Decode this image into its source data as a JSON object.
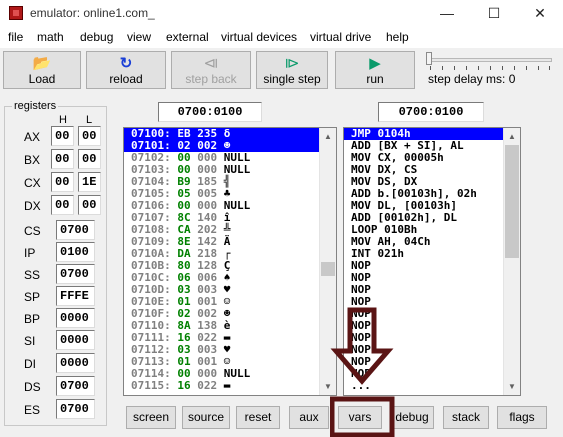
{
  "window": {
    "title": "emulator: online1.com_",
    "minimize": "—",
    "maximize": "☐",
    "close": "✕"
  },
  "menu": [
    "file",
    "math",
    "debug",
    "view",
    "external",
    "virtual devices",
    "virtual drive",
    "help"
  ],
  "toolbar": {
    "load": {
      "label": "Load",
      "icon": "📂"
    },
    "reload": {
      "label": "reload",
      "icon": "↻"
    },
    "step_back": {
      "label": "step back",
      "icon": "⧏",
      "disabled": true
    },
    "single_step": {
      "label": "single step",
      "icon": "⧐"
    },
    "run": {
      "label": "run",
      "icon": "▶"
    },
    "step_delay_label": "step delay ms: 0",
    "step_delay_ms": 0
  },
  "registers": {
    "caption": "registers",
    "h_header": "H",
    "l_header": "L",
    "general": [
      {
        "name": "AX",
        "h": "00",
        "l": "00"
      },
      {
        "name": "BX",
        "h": "00",
        "l": "00"
      },
      {
        "name": "CX",
        "h": "00",
        "l": "1E"
      },
      {
        "name": "DX",
        "h": "00",
        "l": "00"
      }
    ],
    "segment": [
      {
        "name": "CS",
        "value": "0700"
      },
      {
        "name": "IP",
        "value": "0100"
      },
      {
        "name": "SS",
        "value": "0700"
      },
      {
        "name": "SP",
        "value": "FFFE"
      },
      {
        "name": "BP",
        "value": "0000"
      },
      {
        "name": "SI",
        "value": "0000"
      },
      {
        "name": "DI",
        "value": "0000"
      },
      {
        "name": "DS",
        "value": "0700"
      },
      {
        "name": "ES",
        "value": "0700"
      }
    ]
  },
  "memory": {
    "address": "0700:0100",
    "rows": [
      {
        "addr": "07100:",
        "hex": "EB",
        "dec": "235",
        "ch": "δ",
        "selected": true
      },
      {
        "addr": "07101:",
        "hex": "02",
        "dec": "002",
        "ch": "☻",
        "selected": true
      },
      {
        "addr": "07102:",
        "hex": "00",
        "dec": "000",
        "ch": "NULL"
      },
      {
        "addr": "07103:",
        "hex": "00",
        "dec": "000",
        "ch": "NULL"
      },
      {
        "addr": "07104:",
        "hex": "B9",
        "dec": "185",
        "ch": "╣"
      },
      {
        "addr": "07105:",
        "hex": "05",
        "dec": "005",
        "ch": "♣"
      },
      {
        "addr": "07106:",
        "hex": "00",
        "dec": "000",
        "ch": "NULL"
      },
      {
        "addr": "07107:",
        "hex": "8C",
        "dec": "140",
        "ch": "î"
      },
      {
        "addr": "07108:",
        "hex": "CA",
        "dec": "202",
        "ch": "╩"
      },
      {
        "addr": "07109:",
        "hex": "8E",
        "dec": "142",
        "ch": "Ä"
      },
      {
        "addr": "0710A:",
        "hex": "DA",
        "dec": "218",
        "ch": "┌"
      },
      {
        "addr": "0710B:",
        "hex": "80",
        "dec": "128",
        "ch": "Ç"
      },
      {
        "addr": "0710C:",
        "hex": "06",
        "dec": "006",
        "ch": "♠"
      },
      {
        "addr": "0710D:",
        "hex": "03",
        "dec": "003",
        "ch": "♥"
      },
      {
        "addr": "0710E:",
        "hex": "01",
        "dec": "001",
        "ch": "☺"
      },
      {
        "addr": "0710F:",
        "hex": "02",
        "dec": "002",
        "ch": "☻"
      },
      {
        "addr": "07110:",
        "hex": "8A",
        "dec": "138",
        "ch": "è"
      },
      {
        "addr": "07111:",
        "hex": "16",
        "dec": "022",
        "ch": "▬"
      },
      {
        "addr": "07112:",
        "hex": "03",
        "dec": "003",
        "ch": "♥"
      },
      {
        "addr": "07113:",
        "hex": "01",
        "dec": "001",
        "ch": "☺"
      },
      {
        "addr": "07114:",
        "hex": "00",
        "dec": "000",
        "ch": "NULL"
      },
      {
        "addr": "07115:",
        "hex": "16",
        "dec": "022",
        "ch": "▬"
      }
    ]
  },
  "disassembly": {
    "address": "0700:0100",
    "lines": [
      {
        "text": "JMP 0104h",
        "selected": true
      },
      {
        "text": "ADD [BX + SI], AL"
      },
      {
        "text": "MOV CX, 00005h"
      },
      {
        "text": "MOV DX, CS"
      },
      {
        "text": "MOV DS, DX"
      },
      {
        "text": "ADD b.[00103h], 02h"
      },
      {
        "text": "MOV DL, [00103h]"
      },
      {
        "text": "ADD [00102h], DL"
      },
      {
        "text": "LOOP 010Bh"
      },
      {
        "text": "MOV AH, 04Ch"
      },
      {
        "text": "INT 021h"
      },
      {
        "text": "NOP"
      },
      {
        "text": "NOP"
      },
      {
        "text": "NOP"
      },
      {
        "text": "NOP"
      },
      {
        "text": "NOP"
      },
      {
        "text": "NOP"
      },
      {
        "text": "NOP"
      },
      {
        "text": "NOP"
      },
      {
        "text": "NOP"
      },
      {
        "text": "NOP"
      },
      {
        "text": "..."
      }
    ]
  },
  "bottom_buttons": [
    "screen",
    "source",
    "reset",
    "aux",
    "vars",
    "debug",
    "stack",
    "flags"
  ],
  "colors": {
    "selection": "#0000ff",
    "memory_value": "#008000",
    "annotation_arrow": "#5a1414"
  }
}
